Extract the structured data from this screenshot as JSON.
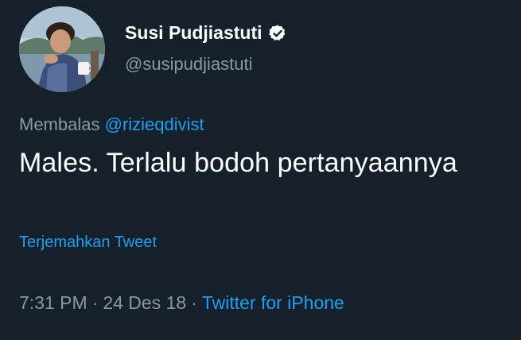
{
  "author": {
    "display_name": "Susi Pudjiastuti",
    "handle": "@susipudjiastuti",
    "verified_icon": "verified-badge-icon",
    "avatar": "avatar-photo"
  },
  "reply": {
    "prefix": "Membalas",
    "mention": "@rizieqdivist"
  },
  "tweet": {
    "text": "Males. Terlalu bodoh pertanyaannya"
  },
  "translate_label": "Terjemahkan Tweet",
  "meta": {
    "time": "7:31 PM",
    "separator": "·",
    "date": "24 Des 18",
    "source": "Twitter for iPhone"
  },
  "colors": {
    "background": "#15202b",
    "accent": "#1da1f2",
    "secondary_text": "#8899a6",
    "primary_text": "#ffffff"
  }
}
